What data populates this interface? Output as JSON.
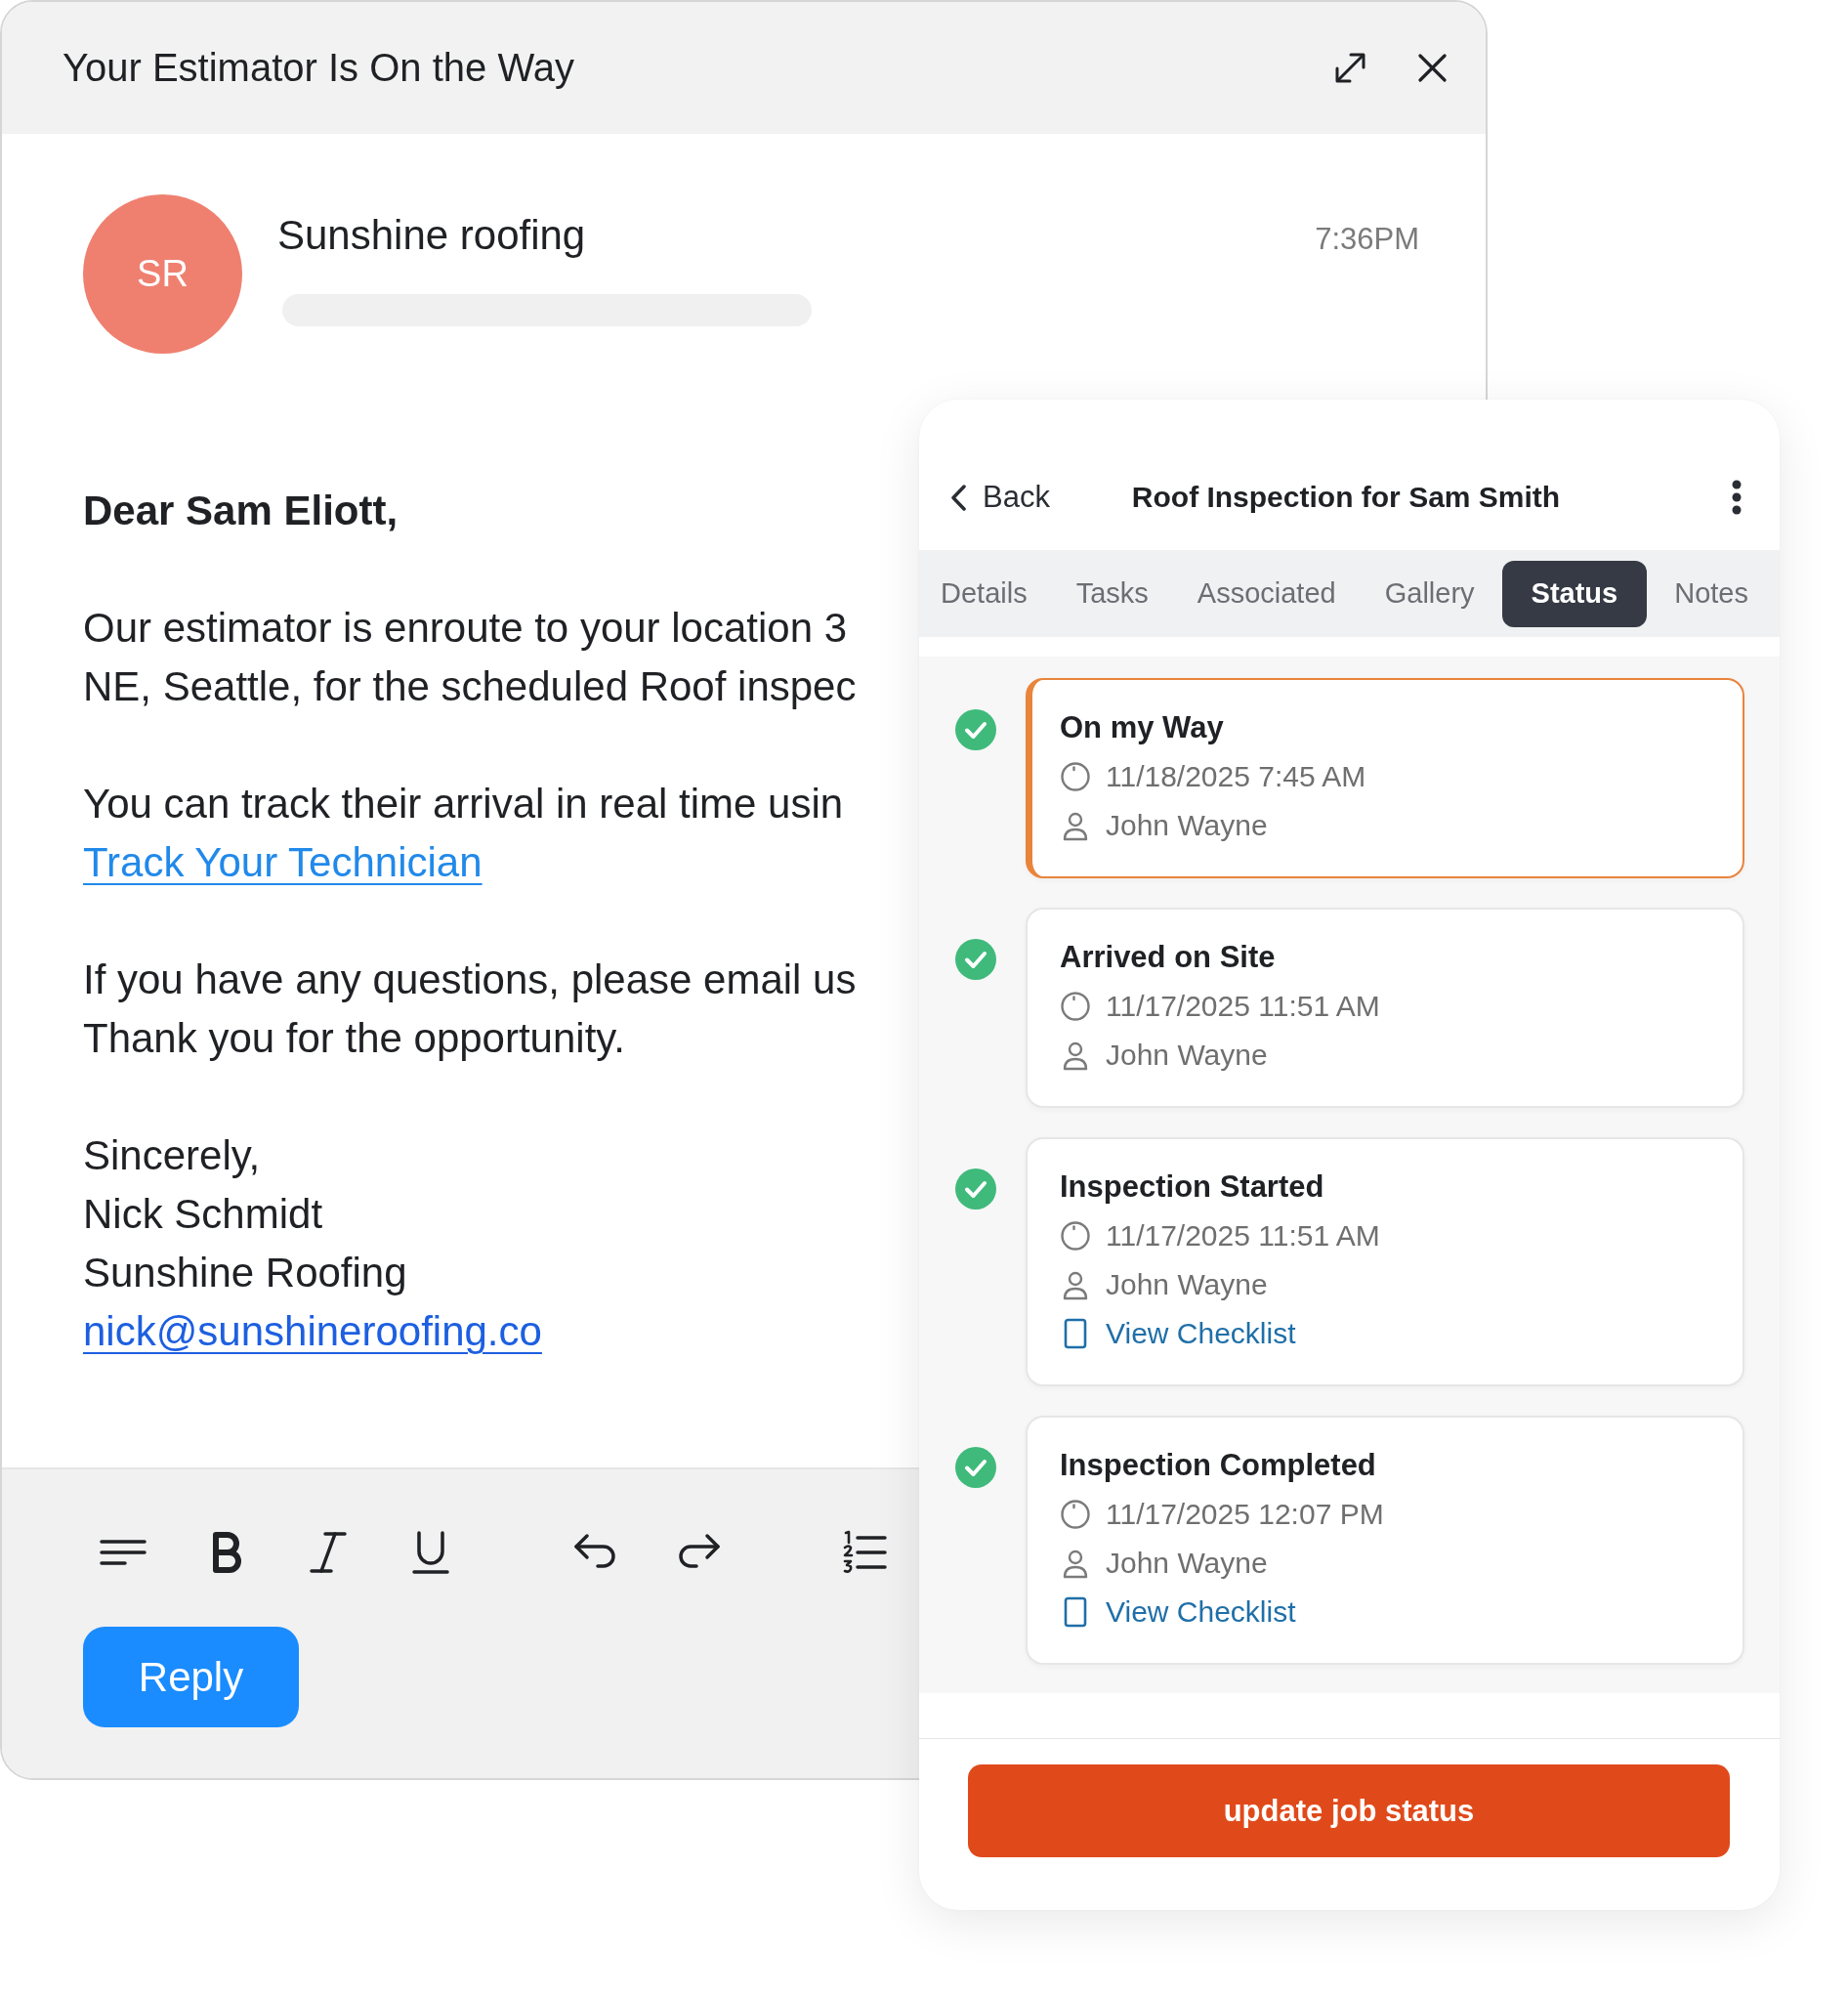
{
  "email_window": {
    "title": "Your Estimator Is On the Way",
    "sender": {
      "initials": "SR",
      "name": "Sunshine roofing",
      "time": "7:36PM"
    },
    "body": [
      {
        "lines": [
          {
            "kind": "bold",
            "text": "Dear Sam Eliott,"
          }
        ]
      },
      {
        "lines": [
          {
            "kind": "text",
            "text": "Our estimator is enroute to your location 3"
          },
          {
            "kind": "text",
            "text": "NE, Seattle, for the scheduled Roof inspec"
          }
        ]
      },
      {
        "lines": [
          {
            "kind": "text",
            "text": "You can track their arrival in real time usin"
          },
          {
            "kind": "link",
            "text": "Track Your Technician"
          }
        ]
      },
      {
        "lines": [
          {
            "kind": "text",
            "text": "If you have any questions, please email us"
          },
          {
            "kind": "text",
            "text": "Thank you for the opportunity."
          }
        ]
      },
      {
        "lines": [
          {
            "kind": "text",
            "text": "Sincerely,"
          },
          {
            "kind": "text",
            "text": "Nick Schmidt"
          },
          {
            "kind": "text",
            "text": "Sunshine Roofing"
          },
          {
            "kind": "email",
            "text": "nick@sunshineroofing.co"
          }
        ]
      }
    ],
    "reply_button": "Reply"
  },
  "job_panel": {
    "back": "Back",
    "title": "Roof Inspection for Sam Smith",
    "tabs": [
      {
        "label": "Details",
        "selected": false
      },
      {
        "label": "Tasks",
        "selected": false
      },
      {
        "label": "Associated",
        "selected": false
      },
      {
        "label": "Gallery",
        "selected": false
      },
      {
        "label": "Status",
        "selected": true
      },
      {
        "label": "Notes",
        "selected": false
      }
    ],
    "statuses": [
      {
        "title": "On my Way",
        "date": "11/18/2025 7:45 AM",
        "person": "John Wayne",
        "done": true,
        "selected": true
      },
      {
        "title": "Arrived on Site",
        "date": "11/17/2025 11:51 AM",
        "person": "John Wayne",
        "done": true,
        "selected": false
      },
      {
        "title": "Inspection Started",
        "date": "11/17/2025 11:51 AM",
        "person": "John Wayne",
        "checklist": "View Checklist",
        "done": true,
        "selected": false
      },
      {
        "title": "Inspection Completed",
        "date": "11/17/2025 12:07 PM",
        "person": "John Wayne",
        "checklist": "View Checklist",
        "done": true,
        "selected": false
      }
    ],
    "action_button": "update job status"
  }
}
